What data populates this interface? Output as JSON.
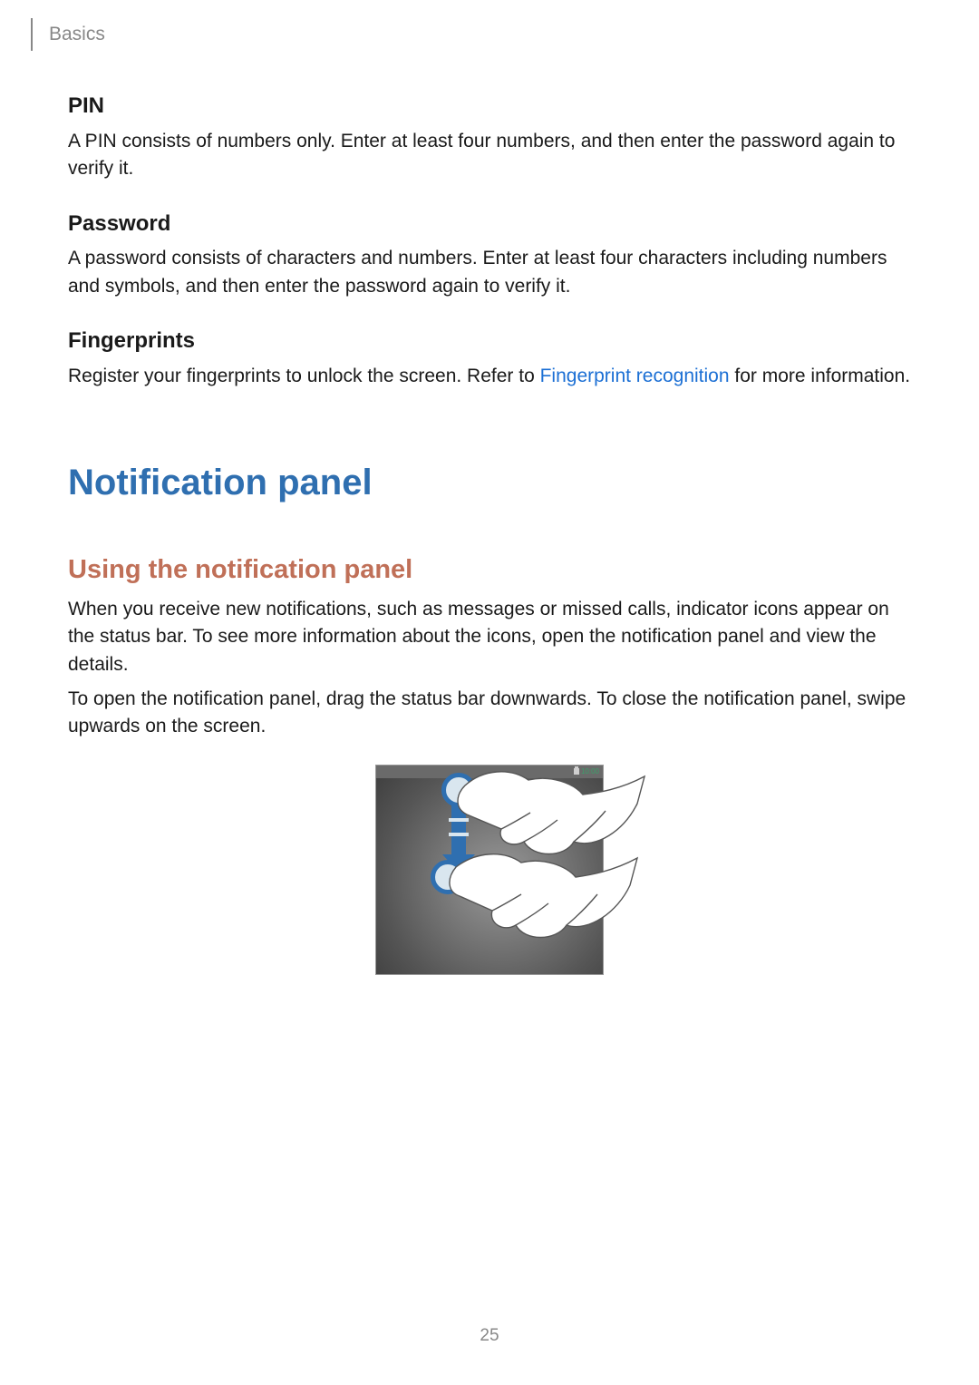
{
  "header": {
    "section": "Basics"
  },
  "sections": {
    "pin": {
      "heading": "PIN",
      "body": "A PIN consists of numbers only. Enter at least four numbers, and then enter the password again to verify it."
    },
    "password": {
      "heading": "Password",
      "body": "A password consists of characters and numbers. Enter at least four characters including numbers and symbols, and then enter the password again to verify it."
    },
    "fingerprints": {
      "heading": "Fingerprints",
      "body_before_link": "Register your fingerprints to unlock the screen. Refer to ",
      "link_text": "Fingerprint recognition",
      "body_after_link": " for more information."
    }
  },
  "main_heading": "Notification panel",
  "sub_heading": "Using the notification panel",
  "paragraphs": {
    "p1": "When you receive new notifications, such as messages or missed calls, indicator icons appear on the status bar. To see more information about the icons, open the notification panel and view the details.",
    "p2": "To open the notification panel, drag the status bar downwards. To close the notification panel, swipe upwards on the screen."
  },
  "figure": {
    "status_time": "10:00"
  },
  "page_number": "25"
}
